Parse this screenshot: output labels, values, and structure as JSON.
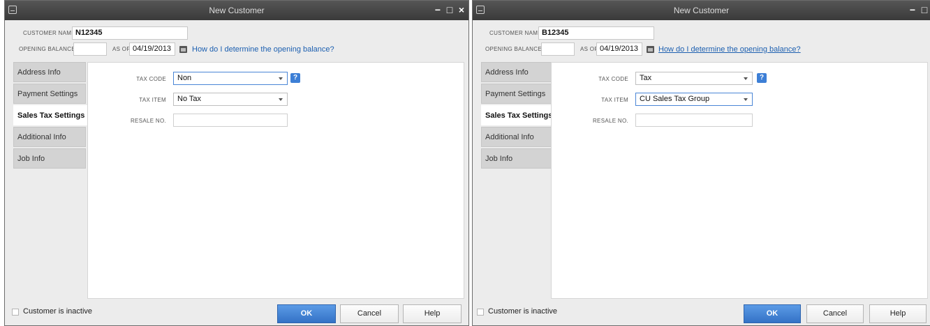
{
  "left": {
    "title": "New Customer",
    "window_controls": {
      "minimize": "−",
      "maximize": "□",
      "close": "×"
    },
    "customer_name_label": "CUSTOMER NAME",
    "customer_name_value": "N12345",
    "opening_balance_label": "OPENING BALANCE",
    "opening_balance_value": "",
    "as_of_label": "AS OF",
    "as_of_value": "04/19/2013",
    "help_link": "How do I determine the opening balance?",
    "tabs": [
      {
        "label": "Address Info",
        "active": false
      },
      {
        "label": "Payment Settings",
        "active": false
      },
      {
        "label": "Sales Tax Settings",
        "active": true
      },
      {
        "label": "Additional Info",
        "active": false
      },
      {
        "label": "Job Info",
        "active": false
      }
    ],
    "tax_code_label": "TAX CODE",
    "tax_code_value": "Non",
    "tax_item_label": "TAX ITEM",
    "tax_item_value": "No Tax",
    "resale_label": "RESALE NO.",
    "resale_value": "",
    "help_q": "?",
    "inactive_label": "Customer is inactive",
    "ok_label": "OK",
    "cancel_label": "Cancel",
    "help_label": "Help"
  },
  "right": {
    "title": "New Customer",
    "window_controls": {
      "minimize": "−",
      "maximize": "□"
    },
    "customer_name_label": "CUSTOMER NAME",
    "customer_name_value": "B12345",
    "opening_balance_label": "OPENING BALANCE",
    "opening_balance_value": "",
    "as_of_label": "AS OF",
    "as_of_value": "04/19/2013",
    "help_link": "How do I determine the opening balance?",
    "tabs": [
      {
        "label": "Address Info",
        "active": false
      },
      {
        "label": "Payment Settings",
        "active": false
      },
      {
        "label": "Sales Tax Settings",
        "active": true
      },
      {
        "label": "Additional Info",
        "active": false
      },
      {
        "label": "Job Info",
        "active": false
      }
    ],
    "tax_code_label": "TAX CODE",
    "tax_code_value": "Tax",
    "tax_item_label": "TAX ITEM",
    "tax_item_value": "CU Sales Tax Group",
    "resale_label": "RESALE NO.",
    "resale_value": "",
    "help_q": "?",
    "inactive_label": "Customer is inactive",
    "ok_label": "OK",
    "cancel_label": "Cancel",
    "help_label": "Help"
  }
}
